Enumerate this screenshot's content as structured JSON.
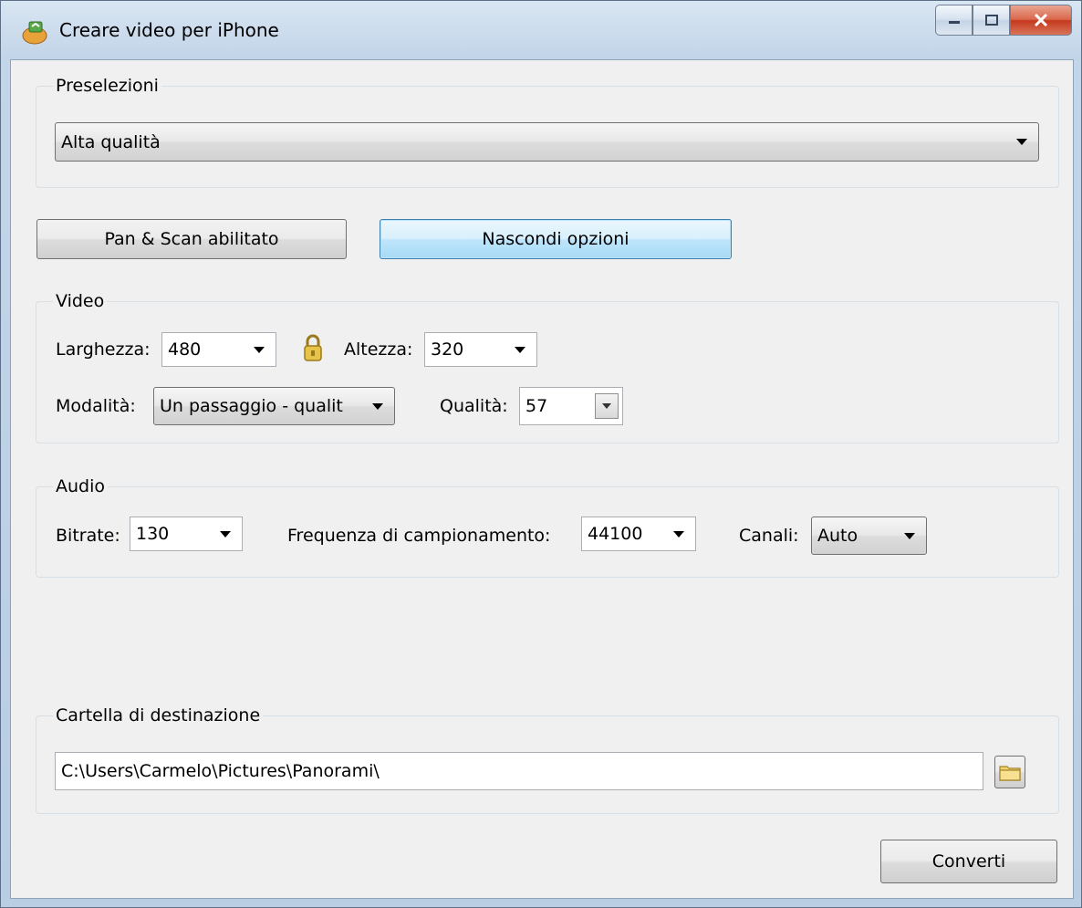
{
  "window": {
    "title": "Creare video per iPhone",
    "icon": "app-icon"
  },
  "presets": {
    "group_label": "Preselezioni",
    "selected": "Alta qualità"
  },
  "buttons": {
    "pan_scan": "Pan & Scan abilitato",
    "hide_options": "Nascondi opzioni",
    "convert": "Converti"
  },
  "video": {
    "group_label": "Video",
    "width_label": "Larghezza:",
    "width_value": "480",
    "lock_icon": "lock-icon",
    "height_label": "Altezza:",
    "height_value": "320",
    "mode_label": "Modalità:",
    "mode_value": "Un passaggio - qualit",
    "quality_label": "Qualità:",
    "quality_value": "57"
  },
  "audio": {
    "group_label": "Audio",
    "bitrate_label": "Bitrate:",
    "bitrate_value": "130",
    "samplerate_label": "Frequenza di campionamento:",
    "samplerate_value": "44100",
    "channels_label": "Canali:",
    "channels_value": "Auto"
  },
  "destination": {
    "group_label": "Cartella di destinazione",
    "path": "C:\\Users\\Carmelo\\Pictures\\Panorami\\"
  }
}
